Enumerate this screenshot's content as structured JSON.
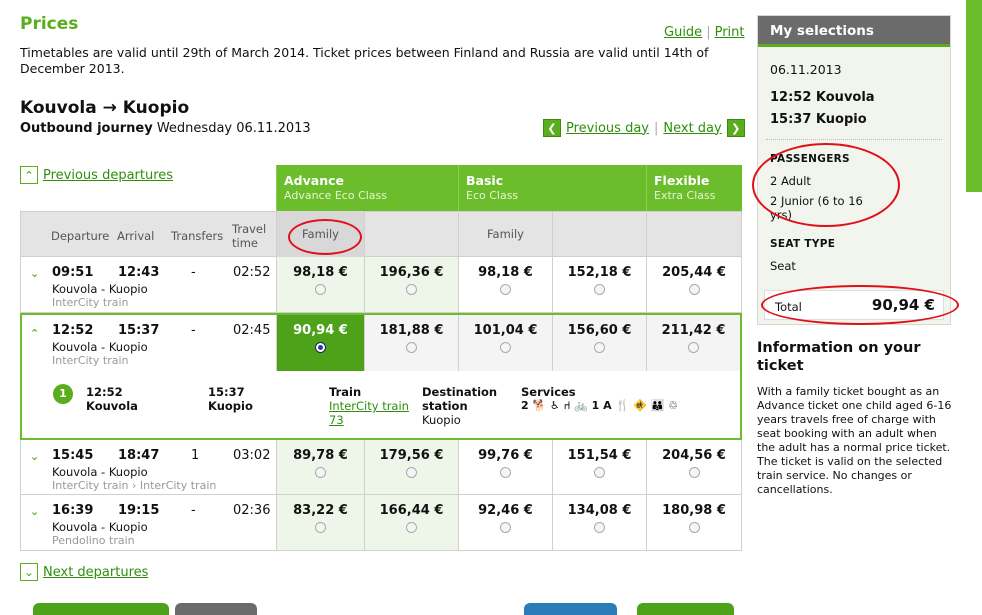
{
  "page": {
    "title": "Prices",
    "guide_link": "Guide",
    "print_link": "Print",
    "validity": "Timetables are valid until 29th of March 2014. Ticket prices between Finland and Russia are valid until 14th of December 2013."
  },
  "journey": {
    "route": "Kouvola → Kuopio",
    "direction_label": "Outbound journey",
    "date": "Wednesday 06.11.2013",
    "prev_day": "Previous day",
    "next_day": "Next day",
    "prev_departures": "Previous departures",
    "next_departures": "Next departures"
  },
  "fares": {
    "advance": {
      "name": "Advance",
      "cls": "Advance Eco Class"
    },
    "basic": {
      "name": "Basic",
      "cls": "Eco Class"
    },
    "flexible": {
      "name": "Flexible",
      "cls": "Extra Class"
    },
    "sub_family_1": "Family",
    "sub_family_2": "Family"
  },
  "columns": {
    "departure": "Departure",
    "arrival": "Arrival",
    "transfers": "Transfers",
    "travel_time": "Travel time"
  },
  "rows": [
    {
      "dep": "09:51",
      "arr": "12:43",
      "transfers": "-",
      "duration": "02:52",
      "stations": "Kouvola - Kuopio",
      "train": "InterCity train",
      "prices": [
        "98,18 €",
        "196,36 €",
        "98,18 €",
        "152,18 €",
        "205,44 €"
      ]
    },
    {
      "dep": "12:52",
      "arr": "15:37",
      "transfers": "-",
      "duration": "02:45",
      "stations": "Kouvola - Kuopio",
      "train": "InterCity train",
      "prices": [
        "90,94 €",
        "181,88 €",
        "101,04 €",
        "156,60 €",
        "211,42 €"
      ]
    },
    {
      "dep": "15:45",
      "arr": "18:47",
      "transfers": "1",
      "duration": "03:02",
      "stations": "Kouvola - Kuopio",
      "train": "InterCity train › InterCity train",
      "prices": [
        "89,78 €",
        "179,56 €",
        "99,76 €",
        "151,54 €",
        "204,56 €"
      ]
    },
    {
      "dep": "16:39",
      "arr": "19:15",
      "transfers": "-",
      "duration": "02:36",
      "stations": "Kouvola - Kuopio",
      "train": "Pendolino train",
      "prices": [
        "83,22 €",
        "166,44 €",
        "92,46 €",
        "134,08 €",
        "180,98 €"
      ]
    }
  ],
  "detail": {
    "leg": "1",
    "dep_time": "12:52",
    "dep_station": "Kouvola",
    "arr_time": "15:37",
    "arr_station": "Kuopio",
    "train_label": "Train",
    "train_link": "InterCity train 73",
    "destination_label": "Destination station",
    "destination": "Kuopio",
    "services_label": "Services",
    "services": "2 🐕 ♿ ⑁ 🚲 1 A 🍴 🚸 👪 ♲"
  },
  "sidebar": {
    "title": "My selections",
    "date": "06.11.2013",
    "dep": "12:52 Kouvola",
    "arr": "15:37 Kuopio",
    "passengers_label": "PASSENGERS",
    "passenger_1": "2 Adult",
    "passenger_2": "2 Junior (6 to 16 yrs)",
    "seat_type_label": "SEAT TYPE",
    "seat_type": "Seat",
    "total_label": "Total",
    "total_value": "90,94 €"
  },
  "info": {
    "title": "Information on your ticket",
    "text": "With a family ticket bought as an Advance ticket one child aged 6-16 years travels free of charge with seat booking with an adult when the adult has a normal price ticket. The ticket is valid on the selected train service. No changes or cancellations."
  },
  "colors": {
    "accent": "#6cbd2b",
    "link": "#2f8f0c",
    "highlight_circle": "#e0101a"
  }
}
